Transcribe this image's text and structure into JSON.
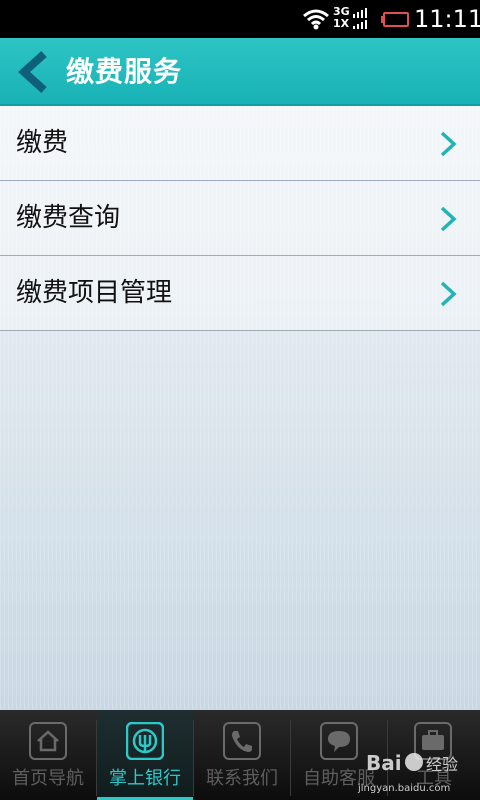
{
  "status_bar": {
    "network": [
      "3G",
      "1X"
    ],
    "time": "11:11"
  },
  "header": {
    "title": "缴费服务",
    "back_icon": "chevron-left-icon"
  },
  "menu": {
    "items": [
      {
        "label": "缴费",
        "icon": "chevron-right-icon"
      },
      {
        "label": "缴费查询",
        "icon": "chevron-right-icon"
      },
      {
        "label": "缴费项目管理",
        "icon": "chevron-right-icon"
      }
    ]
  },
  "bottom_nav": {
    "items": [
      {
        "label": "首页导航",
        "icon": "home-icon",
        "active": false
      },
      {
        "label": "掌上银行",
        "icon": "bank-icon",
        "active": true
      },
      {
        "label": "联系我们",
        "icon": "phone-icon",
        "active": false
      },
      {
        "label": "自助客服",
        "icon": "chat-icon",
        "active": false
      },
      {
        "label": "工具",
        "icon": "toolbox-icon",
        "active": false
      }
    ]
  },
  "watermark": {
    "text": "jingyan.baidu.com"
  },
  "colors": {
    "accent": "#1fb8bb",
    "nav_active": "#2ec8c8",
    "battery_low": "#e05050"
  }
}
